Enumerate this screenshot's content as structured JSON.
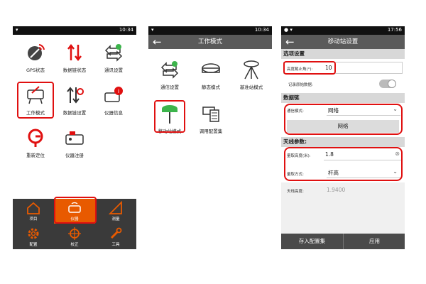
{
  "panel1": {
    "status_time": "10:34",
    "items": [
      {
        "label": "GPS状态"
      },
      {
        "label": "数据链状态"
      },
      {
        "label": "通讯设置"
      },
      {
        "label": "工作模式"
      },
      {
        "label": "数据链设置"
      },
      {
        "label": "仪器信息"
      },
      {
        "label": "重新定位"
      },
      {
        "label": "仪器注册"
      }
    ],
    "nav": [
      {
        "label": "项目"
      },
      {
        "label": "仪器"
      },
      {
        "label": "测量"
      },
      {
        "label": "配置"
      },
      {
        "label": "校正"
      },
      {
        "label": "工具"
      }
    ]
  },
  "panel2": {
    "status_time": "10:34",
    "title": "工作模式",
    "items": [
      {
        "label": "通信设置"
      },
      {
        "label": "静态模式"
      },
      {
        "label": "基准站模式"
      },
      {
        "label": "移动站模式"
      },
      {
        "label": "调用配置集"
      }
    ]
  },
  "panel3": {
    "status_time": "17:56",
    "title": "移动站设置",
    "section_options": "选项设置",
    "elev_label": "高度截止角(°):",
    "elev_value": "10",
    "record_label": "记录原始数据:",
    "section_datalink": "数据链",
    "comm_label": "通信模式:",
    "comm_value": "网络",
    "network_button": "网络",
    "section_antenna": "天线参数:",
    "height_label": "量取高度(米):",
    "height_value": "1.8",
    "method_label": "量取方式:",
    "method_value": "杆高",
    "antenna_height_label": "天线高度:",
    "antenna_height_value": "1.9400",
    "save_button": "存入配置集",
    "apply_button": "应用"
  },
  "colors": {
    "highlight": "#e01010",
    "nav_bg": "#3a3a3a",
    "accent": "#e85a00"
  }
}
